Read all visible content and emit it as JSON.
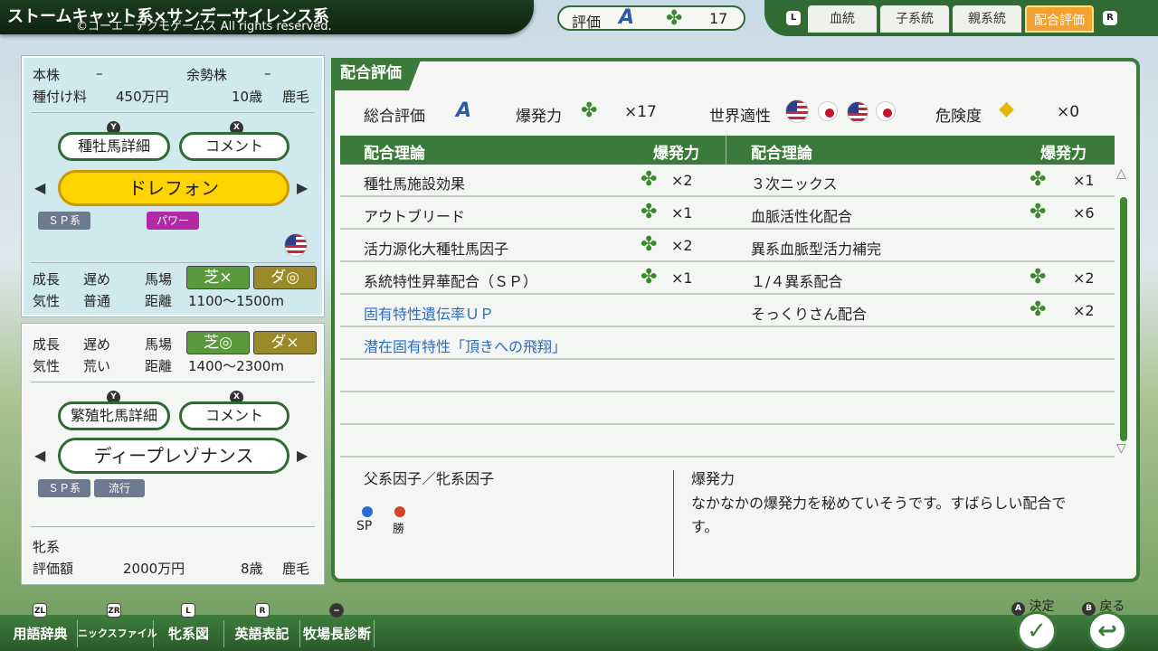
{
  "header": {
    "title": "ストームキャット系×サンデーサイレンス系",
    "copyright": "©コーエーテクモゲームス All rights reserved.",
    "rating_label": "評価",
    "rating_grade": "A",
    "rating_clover_count": "17",
    "tab_l_hint": "L",
    "tab_r_hint": "R",
    "tabs": [
      {
        "label": "血統"
      },
      {
        "label": "子系統"
      },
      {
        "label": "親系統"
      },
      {
        "label": "配合評価"
      }
    ]
  },
  "sire": {
    "honkabu_label": "本株",
    "honkabu_value": "–",
    "yoseikabu_label": "余勢株",
    "yoseikabu_value": "–",
    "fee_label": "種付け料",
    "fee_value": "450万円",
    "age": "10歳",
    "coat": "鹿毛",
    "detail_button": "種牡馬詳細",
    "comment_button": "コメント",
    "y_hint": "Y",
    "x_hint": "X",
    "name": "ドレフォン",
    "tag1": "ＳＰ系",
    "tag2": "パワー",
    "growth_label": "成長",
    "growth_value": "遅め",
    "track_label": "馬場",
    "turf_badge": "芝×",
    "dirt_badge": "ダ◎",
    "temper_label": "気性",
    "temper_value": "普通",
    "distance_label": "距離",
    "distance_value": "1100～1500m"
  },
  "dam": {
    "growth_label": "成長",
    "growth_value": "遅め",
    "track_label": "馬場",
    "turf_badge": "芝◎",
    "dirt_badge": "ダ×",
    "temper_label": "気性",
    "temper_value": "荒い",
    "distance_label": "距離",
    "distance_value": "1400～2300m",
    "detail_button": "繁殖牝馬詳細",
    "comment_button": "コメント",
    "y_hint": "Y",
    "x_hint": "X",
    "name": "ディープレゾナンス",
    "tag1": "ＳＰ系",
    "tag2": "流行",
    "line_label": "牝系",
    "value_label": "評価額",
    "value": "2000万円",
    "age": "8歳",
    "coat": "鹿毛"
  },
  "main": {
    "tab_label": "配合評価",
    "overall_label": "総合評価",
    "overall_grade": "A",
    "burst_label": "爆発力",
    "burst_count": "×17",
    "world_label": "世界適性",
    "danger_label": "危険度",
    "danger_count": "×0",
    "col_theory": "配合理論",
    "col_burst": "爆発力",
    "left_rows": [
      {
        "name": "種牡馬施設効果",
        "mult": "×2",
        "blue": false
      },
      {
        "name": "アウトブリード",
        "mult": "×1",
        "blue": false
      },
      {
        "name": "活力源化大種牡馬因子",
        "mult": "×2",
        "blue": false
      },
      {
        "name": "系統特性昇華配合（ＳＰ）",
        "mult": "×1",
        "blue": false
      },
      {
        "name": "固有特性遺伝率ＵＰ",
        "mult": "",
        "blue": true
      },
      {
        "name": "潜在固有特性「頂きへの飛翔」",
        "mult": "",
        "blue": true
      }
    ],
    "right_rows": [
      {
        "name": "３次ニックス",
        "mult": "×1"
      },
      {
        "name": "血脈活性化配合",
        "mult": "×6"
      },
      {
        "name": "異系血脈型活力補完",
        "mult": ""
      },
      {
        "name": "１/４異系配合",
        "mult": "×2"
      },
      {
        "name": "そっくりさん配合",
        "mult": "×2"
      }
    ],
    "factor_title": "父系因子／牝系因子",
    "factor_sp": "SP",
    "factor_win": "勝",
    "comment_title": "爆発力",
    "comment_text": "なかなかの爆発力を秘めていそうです。すばらしい配合です。"
  },
  "footer": {
    "items": [
      {
        "hint": "ZL",
        "label": "用語辞典"
      },
      {
        "hint": "ZR",
        "label": "ニックスファイル"
      },
      {
        "hint": "L",
        "label": "牝系図"
      },
      {
        "hint": "R",
        "label": "英語表記"
      },
      {
        "hint": "−",
        "label": "牧場長診断"
      }
    ],
    "confirm_hint": "A",
    "confirm_label": "決定",
    "back_hint": "B",
    "back_label": "戻る"
  },
  "colors": {
    "accent_green": "#3b7a3a",
    "sire_name_yellow": "#ffd400",
    "active_tab_orange": "#f2a233",
    "link_blue": "#2a6cc2"
  },
  "icons": [
    "clover-icon",
    "us-flag-icon",
    "japan-flag-icon",
    "warning-icon",
    "check-icon",
    "back-icon",
    "scroll-up-icon",
    "scroll-down-icon"
  ]
}
